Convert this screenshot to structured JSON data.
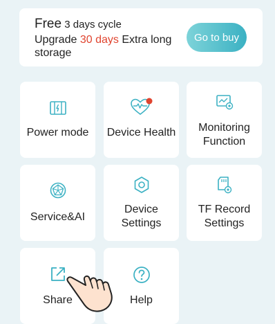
{
  "promo": {
    "line1_prefix": "Free",
    "line1_suffix": "3 days cycle",
    "upgrade": "Upgrade",
    "days": "30 days",
    "rest": "Extra long storage",
    "button": "Go to buy"
  },
  "tiles": [
    {
      "label": "Power mode",
      "icon": "power-mode-icon"
    },
    {
      "label": "Device Health",
      "icon": "heart-icon"
    },
    {
      "label": "Monitoring Function",
      "icon": "monitor-icon"
    },
    {
      "label": "Service&AI",
      "icon": "ai-icon"
    },
    {
      "label": "Device Settings",
      "icon": "settings-icon"
    },
    {
      "label": "TF Record Settings",
      "icon": "sd-card-icon"
    },
    {
      "label": "Share",
      "icon": "share-icon"
    },
    {
      "label": "Help",
      "icon": "help-icon"
    }
  ],
  "colors": {
    "accent": "#3bb1c3",
    "highlight": "#e0442f",
    "background": "#eaf3f6"
  }
}
